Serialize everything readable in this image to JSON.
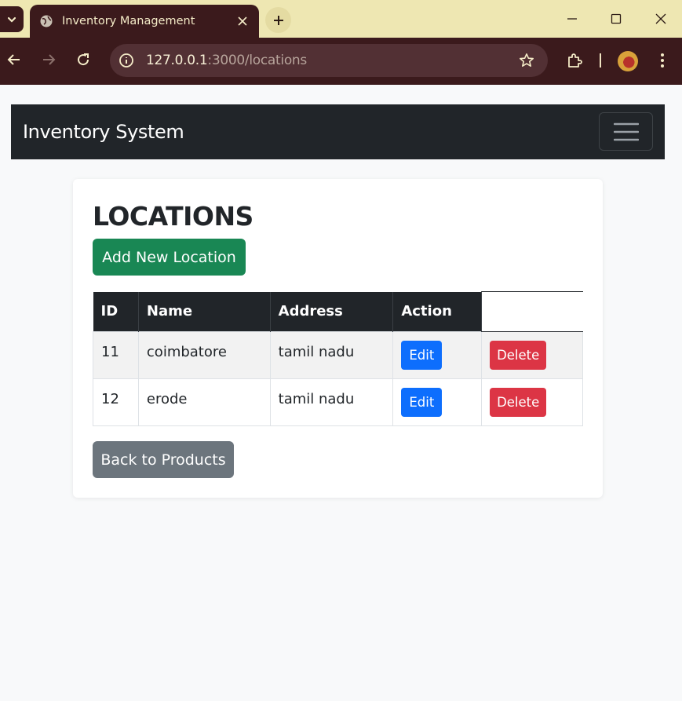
{
  "browser": {
    "tab_title": "Inventory Management",
    "url_host": "127.0.0.1",
    "url_path": ":3000/locations"
  },
  "navbar": {
    "brand": "Inventory System"
  },
  "page": {
    "heading": "LOCATIONS",
    "add_button": "Add New Location",
    "back_button": "Back to Products"
  },
  "table": {
    "headers": [
      "ID",
      "Name",
      "Address",
      "Action"
    ],
    "rows": [
      {
        "id": "11",
        "name": "coimbatore",
        "address": "tamil nadu",
        "edit": "Edit",
        "delete": "Delete"
      },
      {
        "id": "12",
        "name": "erode",
        "address": "tamil nadu",
        "edit": "Edit",
        "delete": "Delete"
      }
    ]
  },
  "colors": {
    "success": "#198754",
    "primary": "#0d6efd",
    "danger": "#dc3545",
    "secondary": "#6c757d",
    "dark": "#212529"
  }
}
